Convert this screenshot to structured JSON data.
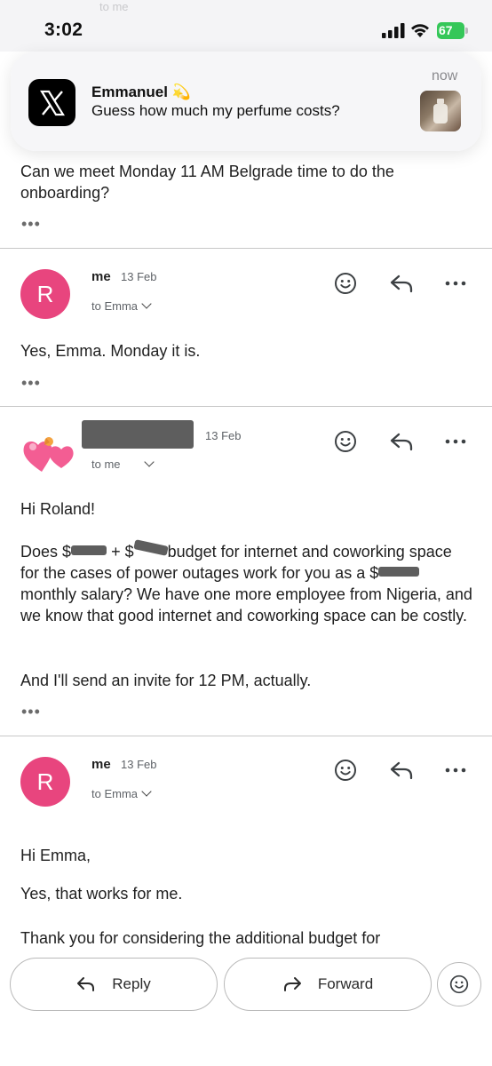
{
  "status_bar": {
    "time": "3:02",
    "battery": "67",
    "ghost_recipient": "to me"
  },
  "notification": {
    "app_icon": "x-logo-icon",
    "sender": "Emmanuel 💫",
    "body": "Guess how much my perfume costs?",
    "time": "now"
  },
  "messages": {
    "m0": {
      "body": "Can we meet Monday 11 AM Belgrade time to do the onboarding?"
    },
    "m1": {
      "avatar_letter": "R",
      "sender": "me",
      "date": "13 Feb",
      "recipient": "to Emma",
      "body": "Yes, Emma. Monday it is."
    },
    "m2": {
      "date": "13 Feb",
      "recipient": "to me",
      "greeting": "Hi Roland!",
      "p1_a": "Does $",
      "p1_b": "+ $",
      "p1_c": "budget for internet and coworking space for the cases of power outages work for you as a $",
      "p1_d": "monthly salary? We have one more employee from Nigeria, and we know that good internet and coworking space can be costly.",
      "p2": "And I'll send an invite for 12 PM, actually."
    },
    "m3": {
      "avatar_letter": "R",
      "sender": "me",
      "date": "13 Feb",
      "recipient": "to Emma",
      "greeting": "Hi Emma,",
      "p1": "Yes, that works for me.",
      "p2": "Thank you for considering the additional budget for"
    }
  },
  "more_dots": "•••",
  "bottom_bar": {
    "reply_label": "Reply",
    "forward_label": "Forward"
  },
  "colors": {
    "avatar": "#e8457e",
    "battery": "#35c759"
  }
}
